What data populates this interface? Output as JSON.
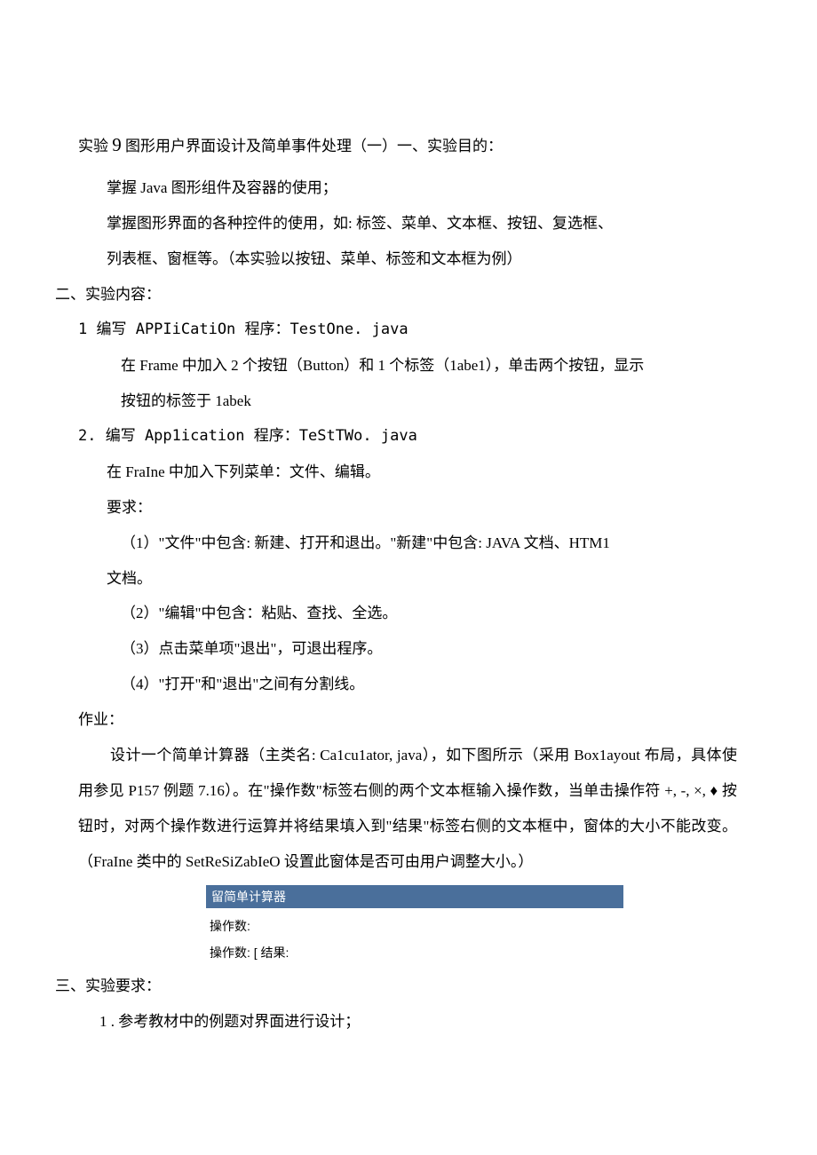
{
  "title_prefix": "实验 ",
  "title_num": "9",
  "title_rest": " 图形用户界面设计及简单事件处理（一）一、实验目的：",
  "goal1": "掌握 Java 图形组件及容器的使用；",
  "goal2": "掌握图形界面的各种控件的使用，如: 标签、菜单、文本框、按钮、复选框、",
  "goal3": "列表框、窗框等。（本实验以按钮、菜单、标签和文本框为例）",
  "sec2": "二、实验内容：",
  "c1": "1 编写 APPIiCatiOn 程序：TestOne. java",
  "c1a": "在 Frame 中加入 2 个按钮（Button）和 1 个标签（1abe1），单击两个按钮，显示",
  "c1b": "按钮的标签于 1abek",
  "c2": "2. 编写 App1ication 程序：TeStTWo. java",
  "c2a": "在 FraIne 中加入下列菜单：文件、编辑。",
  "c2b": "要求：",
  "c2r1": "（1）\"文件\"中包含: 新建、打开和退出。\"新建\"中包含: JAVA 文档、HTM1",
  "c2r1b": "文档。",
  "c2r2": "（2）\"编辑\"中包含：粘贴、查找、全选。",
  "c2r3": "（3）点击菜单项\"退出\"，可退出程序。",
  "c2r4": "（4）\"打开\"和\"退出\"之间有分割线。",
  "hw_h": "作业：",
  "hw1": "设计一个简单计算器（主类名: Ca1cu1ator, java），如下图所示（采用 Box1ayout 布局，具体使用参见 P157 例题 7.16）。在\"操作数\"标签右侧的两个文本框输入操作数，当单击操作符 +, -, ×, ♦ 按钮时，对两个操作数进行运算并将结果填入到\"结果\"标签右侧的文本框中，窗体的大小不能改变。（FraIne 类中的 SetReSiZabIeO 设置此窗体是否可由用户调整大小。）",
  "calc_title": "留简单计算器",
  "calc_row1": "操作数:",
  "calc_row2": "操作数:  [ 结果:",
  "sec3": "三、实验要求：",
  "req1": "1 . 参考教材中的例题对界面进行设计；"
}
